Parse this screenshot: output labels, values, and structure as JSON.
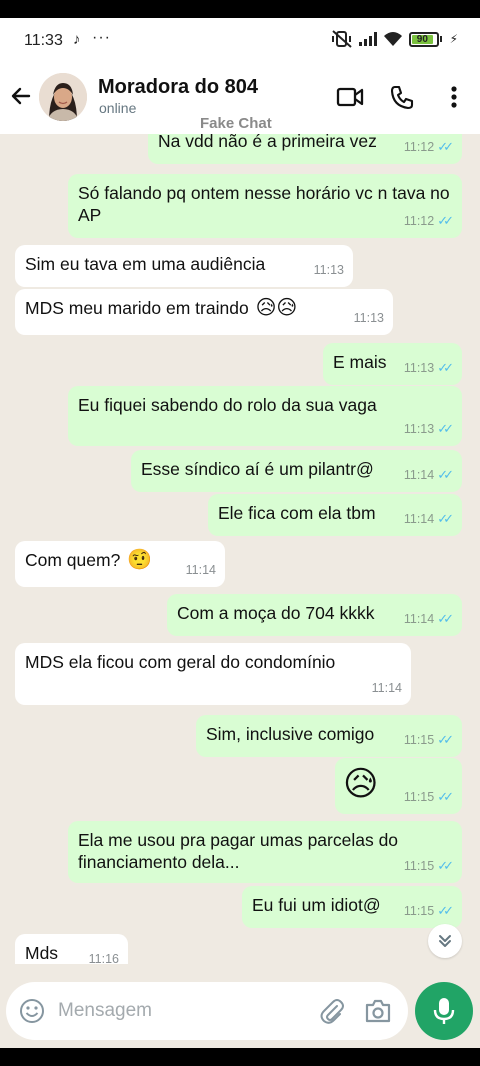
{
  "status": {
    "time": "11:33",
    "tiktok_glyph": "♪",
    "dots": "···",
    "battery": "90",
    "icons": [
      "tiktok-icon",
      "mute-vibrate-icon",
      "signal-icon",
      "wifi-icon",
      "battery-icon",
      "charging-icon"
    ]
  },
  "header": {
    "contact_name": "Moradora do 804",
    "contact_status": "online",
    "watermark": "Fake Chat",
    "icons": [
      "back-arrow-icon",
      "video-call-icon",
      "phone-icon",
      "more-vert-icon"
    ]
  },
  "messages": [
    {
      "dir": "out",
      "text": "Na vdd não é a primeira vez",
      "time": "11:12",
      "read": true
    },
    {
      "dir": "out",
      "text": "Só falando pq ontem nesse horário vc n tava no AP",
      "time": "11:12",
      "read": true
    },
    {
      "dir": "in",
      "text": "Sim eu tava em uma audiência",
      "time": "11:13"
    },
    {
      "dir": "in",
      "text": "MDS meu marido em traindo",
      "emoji": "😥😥",
      "time": "11:13"
    },
    {
      "dir": "out",
      "text": "E mais",
      "time": "11:13",
      "read": true
    },
    {
      "dir": "out",
      "text": "Eu fiquei sabendo do rolo da sua vaga",
      "time": "11:13",
      "read": true
    },
    {
      "dir": "out",
      "text": "Esse síndico aí é um pilantr@",
      "time": "11:14",
      "read": true
    },
    {
      "dir": "out",
      "text": "Ele fica com ela tbm",
      "time": "11:14",
      "read": true
    },
    {
      "dir": "in",
      "text": "Com quem?",
      "emoji": "🤨",
      "time": "11:14"
    },
    {
      "dir": "out",
      "text": "Com a moça do 704 kkkk",
      "time": "11:14",
      "read": true
    },
    {
      "dir": "in",
      "text": "MDS ela ficou com geral do condomínio",
      "time": "11:14"
    },
    {
      "dir": "out",
      "text": "Sim, inclusive comigo",
      "time": "11:15",
      "read": true
    },
    {
      "dir": "out",
      "text": "",
      "emoji": "😥",
      "time": "11:15",
      "read": true
    },
    {
      "dir": "out",
      "text": "Ela me usou pra pagar umas parcelas do financiamento dela...",
      "time": "11:15",
      "read": true
    },
    {
      "dir": "out",
      "text": "Eu fui um idiot@",
      "time": "11:15",
      "read": true
    },
    {
      "dir": "in",
      "text": "Mds",
      "time": "11:16"
    }
  ],
  "input": {
    "placeholder": "Mensagem",
    "icons": [
      "emoji-icon",
      "attach-icon",
      "camera-icon",
      "mic-icon"
    ]
  },
  "colors": {
    "outgoing_bubble": "#d9fdd3",
    "incoming_bubble": "#ffffff",
    "chat_background": "#efeae2",
    "read_ticks": "#53bdeb",
    "mic_button": "#21a466"
  }
}
